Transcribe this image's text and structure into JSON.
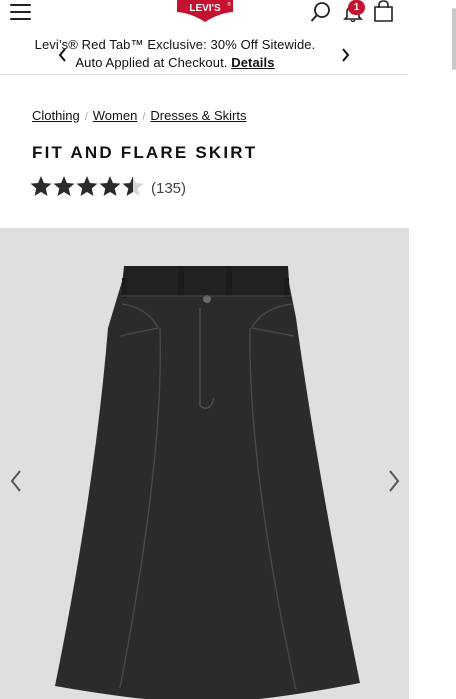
{
  "header": {
    "logo_text": "LEVI'S",
    "bag_badge_count": "1",
    "icons": [
      "menu-icon",
      "search-icon",
      "bell-icon",
      "bag-icon"
    ],
    "brand_color": "#c41230"
  },
  "promo": {
    "message": "Levi’s® Red Tab™ Exclusive: 30% Off Sitewide. Auto Applied at Checkout.",
    "details_link": "Details"
  },
  "breadcrumb": {
    "items": [
      "Clothing",
      "Women",
      "Dresses & Skirts"
    ],
    "separator": "/"
  },
  "product": {
    "title": "Fit and Flare Skirt",
    "rating_value": 4.5,
    "rating_max": 5,
    "review_count": "(135)",
    "image_subject": "black denim fit and flare midi skirt"
  }
}
